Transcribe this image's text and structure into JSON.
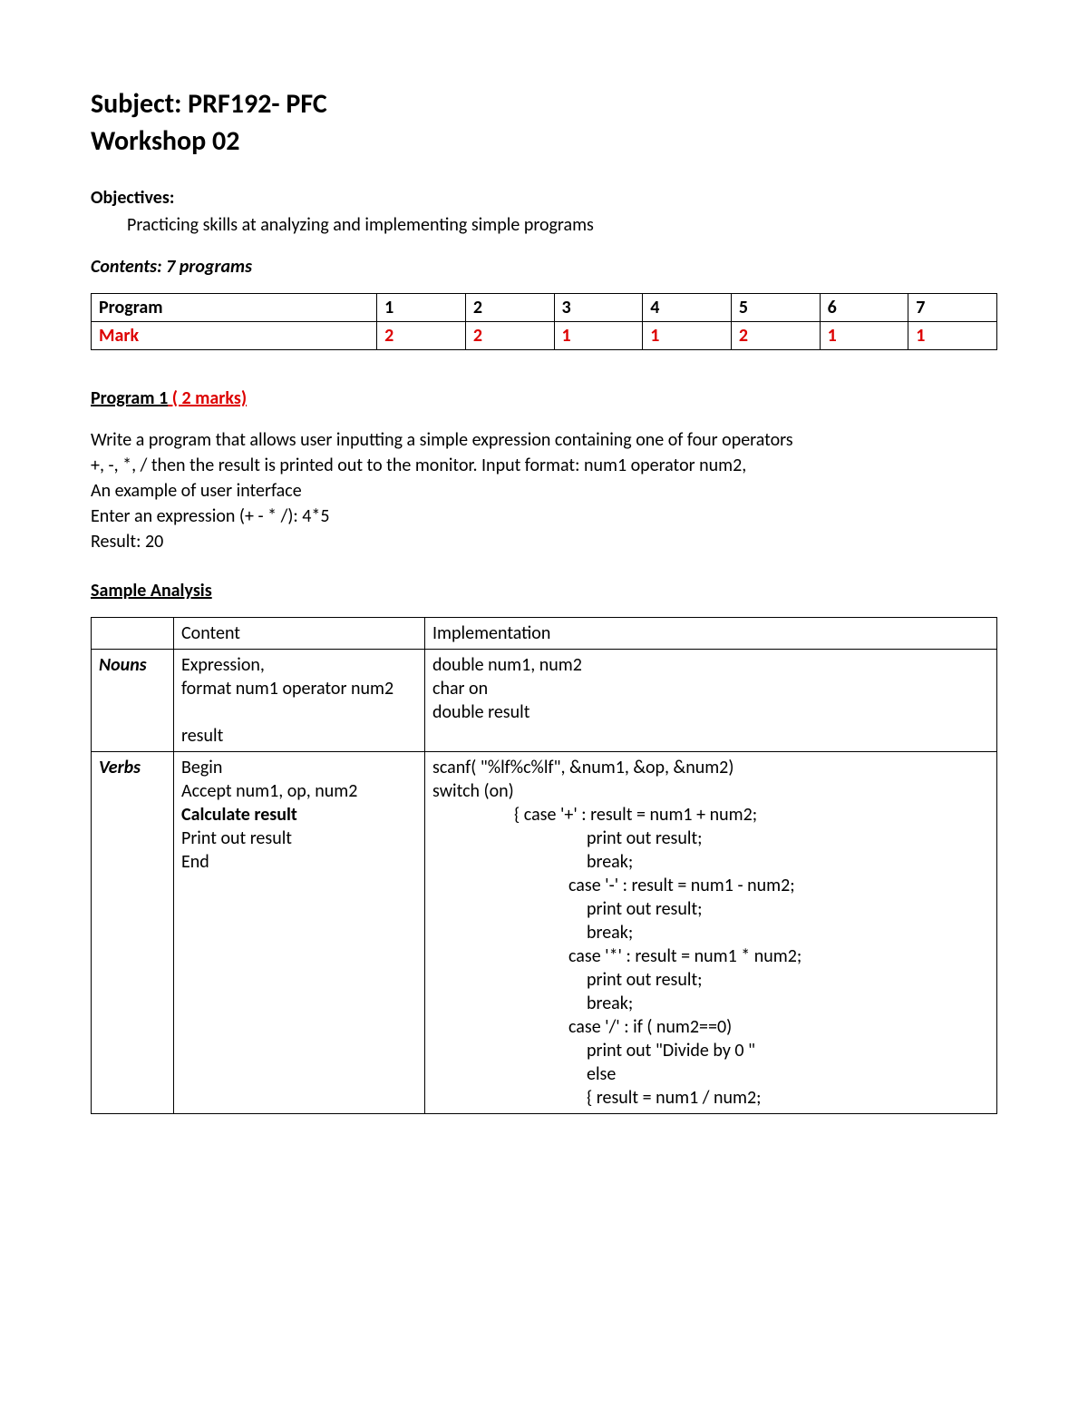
{
  "title_line1": "Subject: PRF192- PFC",
  "title_line2": "Workshop 02",
  "objectives_label": "Objectives:",
  "objectives_text": "Practicing skills at analyzing and implementing simple programs",
  "contents_label": "Contents: 7 programs",
  "marks_table": {
    "header": [
      "Program",
      "1",
      "2",
      "3",
      "4",
      "5",
      "6",
      "7"
    ],
    "row_label": "Mark",
    "marks": [
      "2",
      "2",
      "1",
      "1",
      "2",
      "1",
      "1"
    ]
  },
  "program1": {
    "heading_black": "Program 1",
    "heading_red": " ( 2 marks)",
    "desc": [
      "Write a program that allows user inputting a simple expression containing one of four operators",
      "+, -, *, / then the result is printed out to the monitor. Input format:  num1 operator num2,",
      "An example of user interface",
      "Enter an expression (+ - * /): 4*5",
      "Result: 20"
    ],
    "sample_label": "Sample Analysis",
    "analysis_headers": [
      "",
      "Content",
      "Implementation"
    ],
    "nouns": {
      "label": "Nouns",
      "content": [
        "Expression,",
        "format  num1 operator num2",
        "",
        "result"
      ],
      "impl": [
        "double num1, num2",
        "char on",
        "double result"
      ]
    },
    "verbs": {
      "label": "Verbs",
      "content": [
        "Begin",
        "Accept num1, op, num2",
        "Calculate result",
        "Print out result",
        "End"
      ],
      "impl_lines": [
        {
          "t": "",
          "cls": "indent0"
        },
        {
          "t": "scanf( \"%lf%c%lf\", &num1, &op, &num2)",
          "cls": "indent0"
        },
        {
          "t": "switch (on)",
          "cls": "indent0"
        },
        {
          "t": "{    case '+' : result = num1 + num2;",
          "cls": "indent1"
        },
        {
          "t": "print out result;",
          "cls": "indent3"
        },
        {
          "t": "break;",
          "cls": "indent3"
        },
        {
          "t": "case '-' : result = num1 - num2;",
          "cls": "indent2"
        },
        {
          "t": "print out result;",
          "cls": "indent3"
        },
        {
          "t": "break;",
          "cls": "indent3"
        },
        {
          "t": "case '*' : result = num1 * num2;",
          "cls": "indent2"
        },
        {
          "t": "print out result;",
          "cls": "indent3"
        },
        {
          "t": "break;",
          "cls": "indent3"
        },
        {
          "t": "case '/' : if ( num2==0)",
          "cls": "indent2"
        },
        {
          "t": "   print out \"Divide by 0 \"",
          "cls": "indent3"
        },
        {
          "t": "else",
          "cls": "indent3"
        },
        {
          "t": " { result = num1 / num2;",
          "cls": "indent3"
        }
      ]
    }
  }
}
